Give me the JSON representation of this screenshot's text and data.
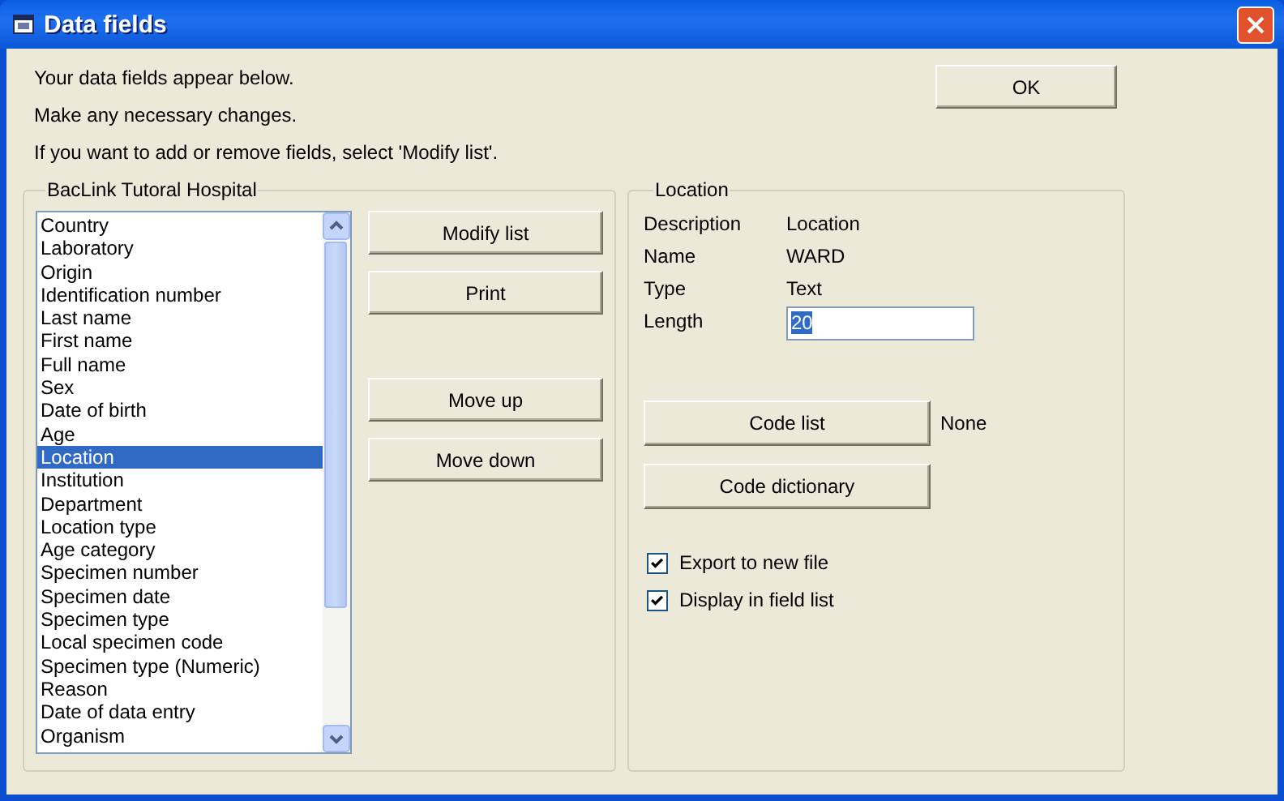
{
  "window": {
    "title": "Data fields"
  },
  "instructions": [
    "Your data fields appear below.",
    "Make any necessary changes.",
    "If you want to add or remove fields, select 'Modify list'."
  ],
  "ok_button": "OK",
  "field_group": {
    "title": "BacLink Tutoral Hospital",
    "fields": [
      {
        "label": "Country",
        "selected": false
      },
      {
        "label": "Laboratory",
        "selected": false
      },
      {
        "label": "Origin",
        "selected": false
      },
      {
        "label": "Identification number",
        "selected": false
      },
      {
        "label": "Last name",
        "selected": false
      },
      {
        "label": "First name",
        "selected": false
      },
      {
        "label": "Full name",
        "selected": false
      },
      {
        "label": "Sex",
        "selected": false
      },
      {
        "label": "Date of birth",
        "selected": false
      },
      {
        "label": "Age",
        "selected": false
      },
      {
        "label": "Location",
        "selected": true
      },
      {
        "label": "Institution",
        "selected": false
      },
      {
        "label": "Department",
        "selected": false
      },
      {
        "label": "Location type",
        "selected": false
      },
      {
        "label": "Age category",
        "selected": false
      },
      {
        "label": "Specimen number",
        "selected": false
      },
      {
        "label": "Specimen date",
        "selected": false
      },
      {
        "label": "Specimen type",
        "selected": false
      },
      {
        "label": "Local specimen code",
        "selected": false
      },
      {
        "label": "Specimen type (Numeric)",
        "selected": false
      },
      {
        "label": "Reason",
        "selected": false
      },
      {
        "label": "Date of data entry",
        "selected": false
      },
      {
        "label": "Organism",
        "selected": false
      }
    ],
    "button_groups": [
      {
        "buttons": [
          "Modify list",
          "Print"
        ]
      },
      {
        "buttons": [
          "Move up",
          "Move down"
        ]
      }
    ]
  },
  "details": {
    "title": "Location",
    "properties": [
      {
        "label": "Description",
        "value": "Location",
        "kind": "text"
      },
      {
        "label": "Name",
        "value": "WARD",
        "kind": "text"
      },
      {
        "label": "Type",
        "value": "Text",
        "kind": "text"
      },
      {
        "label": "Length",
        "value": "20",
        "kind": "input",
        "text_selected": true
      }
    ],
    "code_list_button": "Code list",
    "code_list_value": "None",
    "code_dictionary_button": "Code dictionary",
    "options": [
      {
        "label": "Export to new file",
        "checked": true
      },
      {
        "label": "Display in field list",
        "checked": true
      }
    ]
  }
}
